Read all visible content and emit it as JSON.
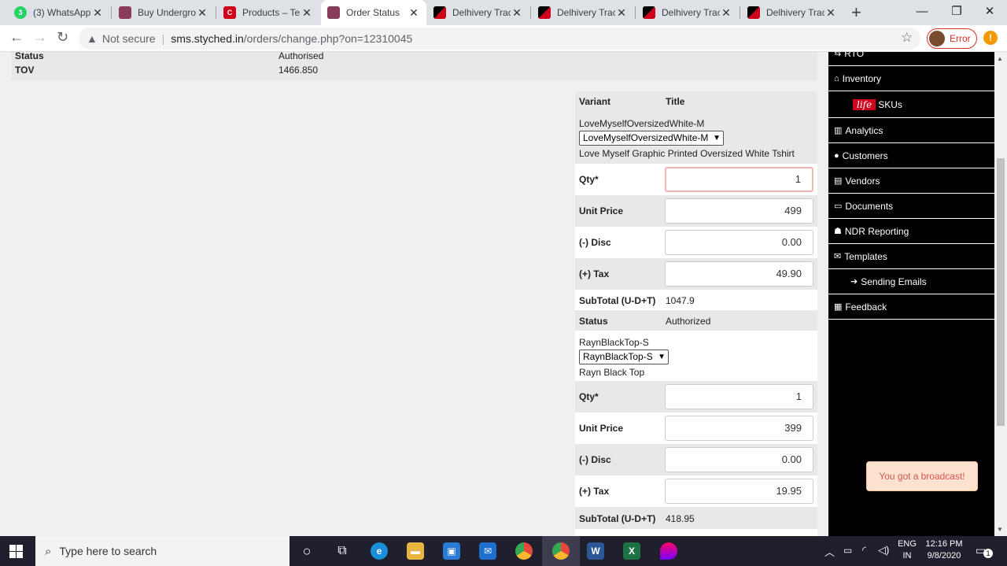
{
  "browser": {
    "tabs": [
      {
        "title": "(3) WhatsApp",
        "favicon": "whatsapp-icon",
        "color": "#25d366",
        "badge": "3"
      },
      {
        "title": "Buy Undergro",
        "favicon": "styched-icon",
        "color": "#8a3c5c",
        "badge": ""
      },
      {
        "title": "Products – Te",
        "favicon": "c-icon",
        "color": "#d0021b",
        "badge": "C"
      },
      {
        "title": "Order Status",
        "favicon": "styched-icon",
        "color": "#8a3c5c",
        "badge": ""
      },
      {
        "title": "Delhivery Trac",
        "favicon": "delhivery-icon",
        "color": "#d0021b",
        "badge": ""
      },
      {
        "title": "Delhivery Trac",
        "favicon": "delhivery-icon",
        "color": "#d0021b",
        "badge": ""
      },
      {
        "title": "Delhivery Trac",
        "favicon": "delhivery-icon",
        "color": "#d0021b",
        "badge": ""
      },
      {
        "title": "Delhivery Trac",
        "favicon": "delhivery-icon",
        "color": "#d0021b",
        "badge": ""
      }
    ],
    "close_glyph": "✕",
    "newtab_glyph": "+",
    "minimize_glyph": "—",
    "maximize_glyph": "❐",
    "winclose_glyph": "✕",
    "back_glyph": "←",
    "forward_glyph": "→",
    "reload_glyph": "↻",
    "warn_glyph": "▲",
    "not_secure": "Not secure",
    "sep": "|",
    "url_domain": "sms.styched.in",
    "url_path": "/orders/change.php?on=12310045",
    "star_glyph": "☆",
    "error_label": "Error",
    "menu_glyph": "!"
  },
  "order_summary": {
    "status_label": "Status",
    "status_value": "Authorised",
    "tov_label": "TOV",
    "tov_value": "1466.850"
  },
  "items_panel": {
    "header_variant": "Variant",
    "header_title": "Title",
    "qty_label": "Qty*",
    "unit_price_label": "Unit Price",
    "disc_label": "(-) Disc",
    "tax_label": "(+) Tax",
    "subtotal_label": "SubTotal (U-D+T)",
    "status_label": "Status",
    "items": [
      {
        "variant": "LoveMyselfOversizedWhite-M",
        "selected": "LoveMyselfOversizedWhite-M",
        "title": "Love Myself Graphic Printed Oversized White Tshirt",
        "qty": "1",
        "unit_price": "499",
        "disc": "0.00",
        "tax": "49.90",
        "subtotal": "1047.9",
        "status": "Authorized"
      },
      {
        "variant": "RaynBlackTop-S",
        "selected": "RaynBlackTop-S",
        "title": "Rayn Black Top",
        "qty": "1",
        "unit_price": "399",
        "disc": "0.00",
        "tax": "19.95",
        "subtotal": "418.95"
      }
    ]
  },
  "sidebar": {
    "items": [
      {
        "label": "RTO",
        "icon": "rto-icon",
        "glyph": "⇆"
      },
      {
        "label": "Inventory",
        "icon": "home-icon",
        "glyph": "⌂"
      },
      {
        "label": "SKUs",
        "icon": "life-logo",
        "glyph": "life"
      },
      {
        "label": "Analytics",
        "icon": "barchart-icon",
        "glyph": "▥"
      },
      {
        "label": "Customers",
        "icon": "user-icon",
        "glyph": "●"
      },
      {
        "label": "Vendors",
        "icon": "file-icon",
        "glyph": "▤"
      },
      {
        "label": "Documents",
        "icon": "card-icon",
        "glyph": "▭"
      },
      {
        "label": "NDR Reporting",
        "icon": "ndr-icon",
        "glyph": "☗"
      },
      {
        "label": "Templates",
        "icon": "envelope-icon",
        "glyph": "✉"
      },
      {
        "label": "Sending Emails",
        "icon": "arrow-right-icon",
        "glyph": "➔"
      },
      {
        "label": "Feedback",
        "icon": "table-icon",
        "glyph": "▦"
      }
    ]
  },
  "toast": {
    "text": "You got a",
    "link": "broadcast!"
  },
  "taskbar": {
    "search_placeholder": "Type here to search",
    "search_glyph": "⌕",
    "lang": "ENG",
    "region": "IN",
    "time": "12:16 PM",
    "date": "9/8/2020",
    "notifications": "1",
    "apps": [
      {
        "name": "cortana-icon",
        "color": "#1f1f2e",
        "glyph": "○"
      },
      {
        "name": "task-view-icon",
        "color": "#1f1f2e",
        "glyph": "⧉"
      },
      {
        "name": "edge-icon",
        "color": "#1c8fd8",
        "glyph": "e"
      },
      {
        "name": "file-explorer-icon",
        "color": "#e8b440",
        "glyph": "▬"
      },
      {
        "name": "store-icon",
        "color": "#2a7bd6",
        "glyph": "▣"
      },
      {
        "name": "mail-icon",
        "color": "#1f6fcf",
        "glyph": "✉"
      },
      {
        "name": "chrome-icon",
        "color": "#e8453c",
        "glyph": "◉"
      },
      {
        "name": "chrome-active-icon",
        "color": "#e8453c",
        "glyph": "◉"
      },
      {
        "name": "word-icon",
        "color": "#2b5797",
        "glyph": "W"
      },
      {
        "name": "excel-icon",
        "color": "#1e7145",
        "glyph": "X"
      },
      {
        "name": "flame-icon",
        "color": "#8a5cf6",
        "glyph": "◆"
      }
    ]
  }
}
